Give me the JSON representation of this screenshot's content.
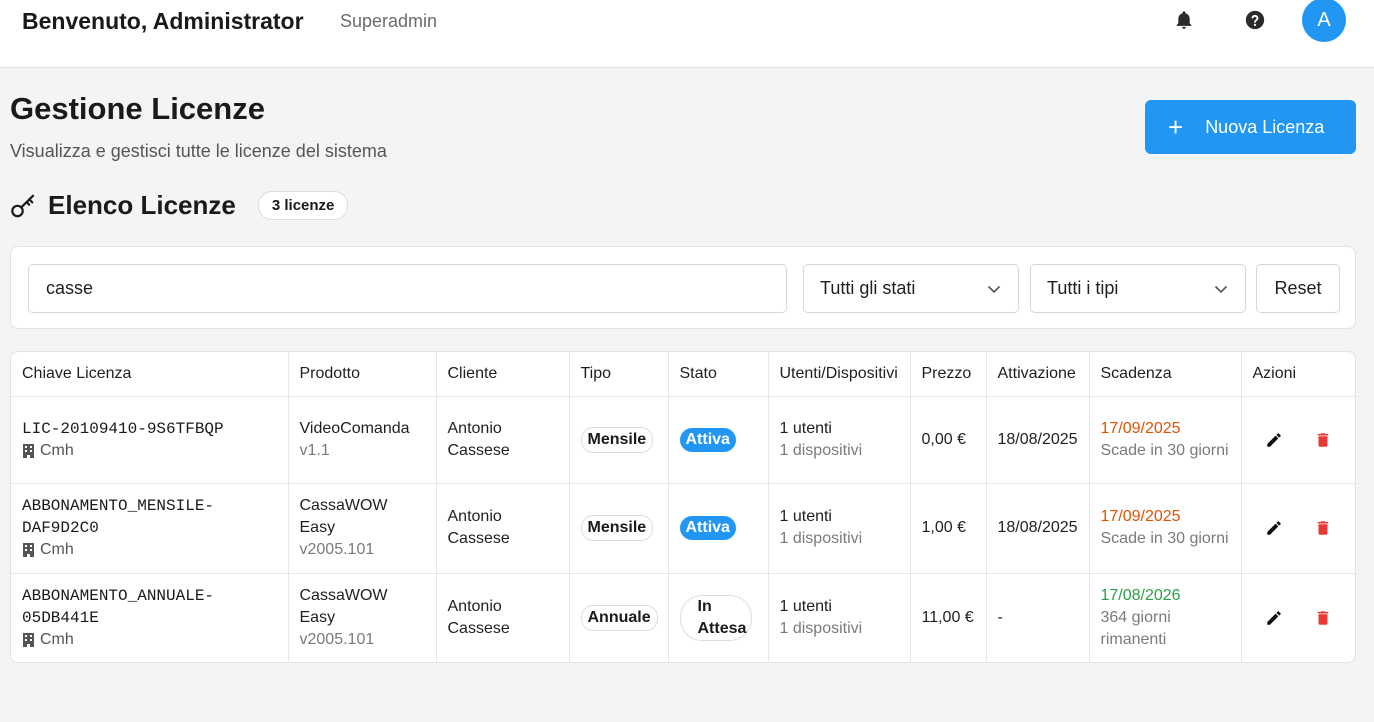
{
  "header": {
    "welcome": "Benvenuto, Administrator",
    "role": "Superadmin",
    "avatar_initial": "A"
  },
  "page": {
    "title": "Gestione Licenze",
    "subtitle": "Visualizza e gestisci tutte le licenze del sistema",
    "new_button_label": "Nuova Licenza"
  },
  "list": {
    "title": "Elenco Licenze",
    "count_badge": "3 licenze"
  },
  "filters": {
    "search_value": "casse",
    "status_select": "Tutti gli stati",
    "type_select": "Tutti i tipi",
    "reset_label": "Reset"
  },
  "table": {
    "columns": [
      "Chiave Licenza",
      "Prodotto",
      "Cliente",
      "Tipo",
      "Stato",
      "Utenti/Dispositivi",
      "Prezzo",
      "Attivazione",
      "Scadenza",
      "Azioni"
    ],
    "rows": [
      {
        "key": "LIC-20109410-9S6TFBQP",
        "company": "Cmh",
        "product": "VideoComanda",
        "version": "v1.1",
        "client": "Antonio Cassese",
        "type": "Mensile",
        "status": "Attiva",
        "users": "1 utenti",
        "devices": "1 dispositivi",
        "price": "0,00 €",
        "activation": "18/08/2025",
        "expiry_date": "17/09/2025",
        "expiry_note": "Scade in 30 giorni"
      },
      {
        "key": "ABBONAMENTO_MENSILE-DAF9D2C0",
        "company": "Cmh",
        "product": "CassaWOW Easy",
        "version": "v2005.101",
        "client": "Antonio Cassese",
        "type": "Mensile",
        "status": "Attiva",
        "users": "1 utenti",
        "devices": "1 dispositivi",
        "price": "1,00 €",
        "activation": "18/08/2025",
        "expiry_date": "17/09/2025",
        "expiry_note": "Scade in 30 giorni"
      },
      {
        "key": "ABBONAMENTO_ANNUALE-05DB441E",
        "company": "Cmh",
        "product": "CassaWOW Easy",
        "version": "v2005.101",
        "client": "Antonio Cassese",
        "type": "Annuale",
        "status": "In Attesa",
        "users": "1 utenti",
        "devices": "1 dispositivi",
        "price": "11,00 €",
        "activation": "-",
        "expiry_date": "17/08/2026",
        "expiry_note": "364 giorni rimanenti"
      }
    ]
  },
  "icons": {
    "notifications": "bell-icon",
    "help": "help-icon",
    "key": "key-icon",
    "company": "building-icon",
    "edit": "pencil-icon",
    "delete": "trash-icon"
  },
  "colors": {
    "primary": "#2196f3",
    "danger": "#e53935",
    "expiry_warning": "#e65100",
    "expiry_ok": "#2e9e47"
  }
}
